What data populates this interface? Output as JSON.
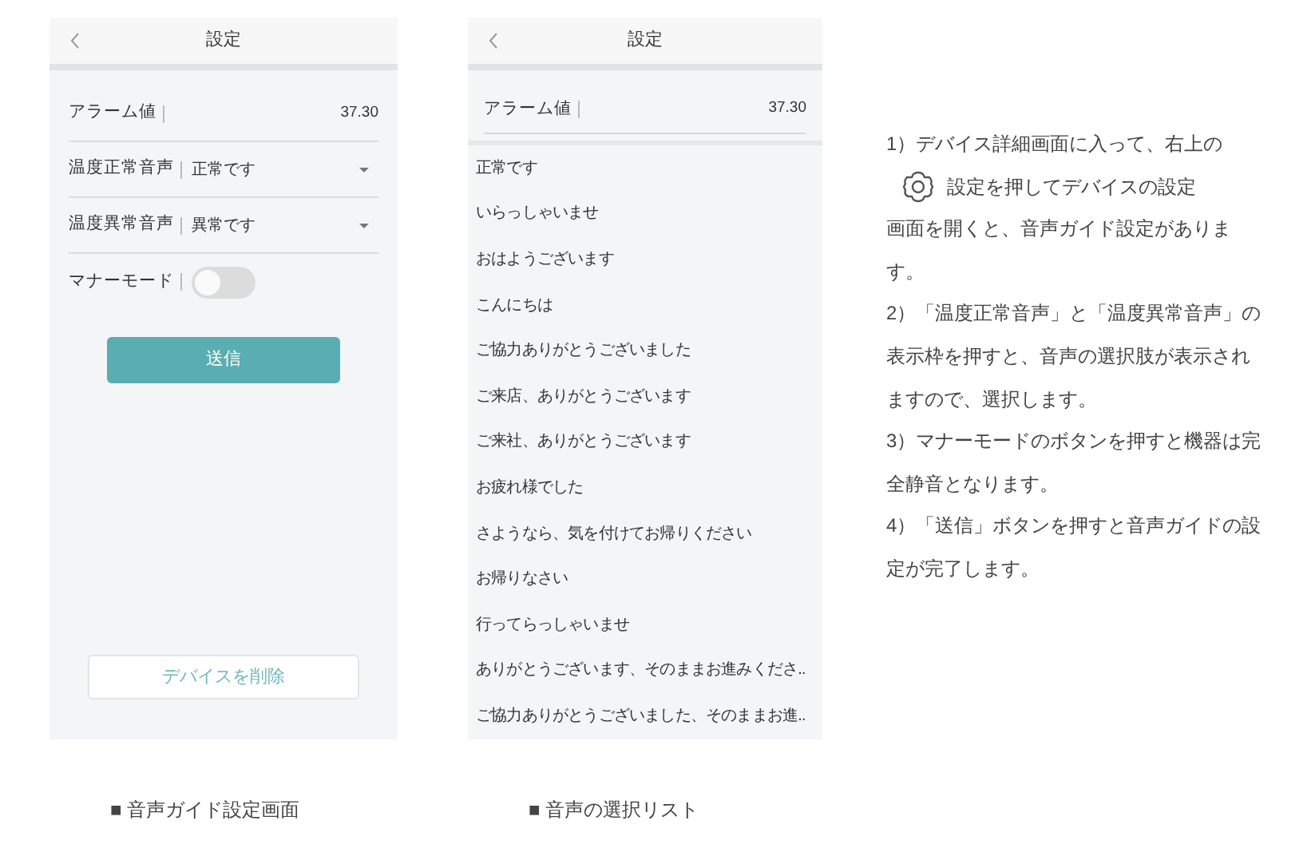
{
  "phone_settings": {
    "header": {
      "title": "設定"
    },
    "fields": [
      {
        "kind": "value",
        "label": "アラーム値",
        "value": "37.30"
      },
      {
        "kind": "select",
        "label": "温度正常音声",
        "value": "正常です"
      },
      {
        "kind": "select",
        "label": "温度異常音声",
        "value": "異常です"
      },
      {
        "kind": "toggle",
        "label": "マナーモード",
        "on": false
      }
    ],
    "submit_button": "送信",
    "delete_button": "デバイスを削除"
  },
  "phone_list": {
    "header": {
      "title": "設定"
    },
    "field": {
      "label": "アラーム値",
      "value": "37.30"
    },
    "options": [
      "正常です",
      "いらっしゃいませ",
      "おはようございます",
      "こんにちは",
      "ご協力ありがとうございました",
      "ご来店、ありがとうございます",
      "ご来社、ありがとうございます",
      "お疲れ様でした",
      "さようなら、気を付けてお帰りください",
      "お帰りなさい",
      "行ってらっしゃいませ",
      "ありがとうございます、そのままお進みくださ..",
      "ご協力ありがとうございました、そのままお進.."
    ]
  },
  "instructions": [
    {
      "parts": [
        {
          "kind": "text",
          "text": "1）デバイス詳細画面に入って、右上の"
        },
        {
          "kind": "icon"
        },
        {
          "kind": "text",
          "text": "設定を押してデバイスの設定"
        },
        {
          "kind": "line",
          "text": "画面を開くと、音声ガイド設定があります。"
        }
      ]
    },
    {
      "parts": [
        {
          "kind": "text",
          "text": "2）「温度正常音声」と「温度異常音声」の表示枠を押すと、音声の選択肢が表示されますので、選択します。"
        }
      ]
    },
    {
      "parts": [
        {
          "kind": "text",
          "text": "3）マナーモードのボタンを押すと機器は完全静音となります。"
        }
      ]
    },
    {
      "parts": [
        {
          "kind": "text",
          "text": "4）「送信」ボタンを押すと音声ガイドの設定が完了します。"
        }
      ]
    }
  ],
  "captions": [
    "■ 音声ガイド設定画面",
    "■ 音声の選択リスト"
  ]
}
